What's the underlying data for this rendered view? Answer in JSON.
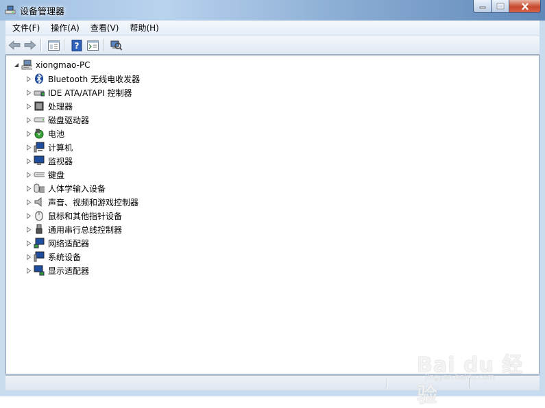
{
  "window": {
    "title": "设备管理器",
    "icon": "device-manager-icon"
  },
  "menu": [
    {
      "label": "文件(F)"
    },
    {
      "label": "操作(A)"
    },
    {
      "label": "查看(V)"
    },
    {
      "label": "帮助(H)"
    }
  ],
  "toolbar": {
    "buttons": [
      "back-arrow-icon",
      "forward-arrow-icon",
      "show-hide-console-tree-icon",
      "help-icon",
      "properties-icon",
      "scan-hardware-icon"
    ]
  },
  "tree": {
    "root": {
      "label": "xiongmao-PC",
      "icon": "computer-icon",
      "expanded": true
    },
    "nodes": [
      {
        "label": "Bluetooth 无线电收发器",
        "icon": "bluetooth-icon"
      },
      {
        "label": "IDE ATA/ATAPI 控制器",
        "icon": "ide-controller-icon"
      },
      {
        "label": "处理器",
        "icon": "processor-icon"
      },
      {
        "label": "磁盘驱动器",
        "icon": "disk-drive-icon"
      },
      {
        "label": "电池",
        "icon": "battery-icon"
      },
      {
        "label": "计算机",
        "icon": "computer-icon"
      },
      {
        "label": "监视器",
        "icon": "monitor-icon"
      },
      {
        "label": "键盘",
        "icon": "keyboard-icon"
      },
      {
        "label": "人体学输入设备",
        "icon": "hid-icon"
      },
      {
        "label": "声音、视频和游戏控制器",
        "icon": "sound-icon"
      },
      {
        "label": "鼠标和其他指针设备",
        "icon": "mouse-icon"
      },
      {
        "label": "通用串行总线控制器",
        "icon": "usb-icon"
      },
      {
        "label": "网络适配器",
        "icon": "network-adapter-icon"
      },
      {
        "label": "系统设备",
        "icon": "system-devices-icon"
      },
      {
        "label": "显示适配器",
        "icon": "display-adapter-icon"
      }
    ]
  },
  "watermark": {
    "main": "Bai du 经验",
    "sub": "jingyan.baidu.com"
  }
}
